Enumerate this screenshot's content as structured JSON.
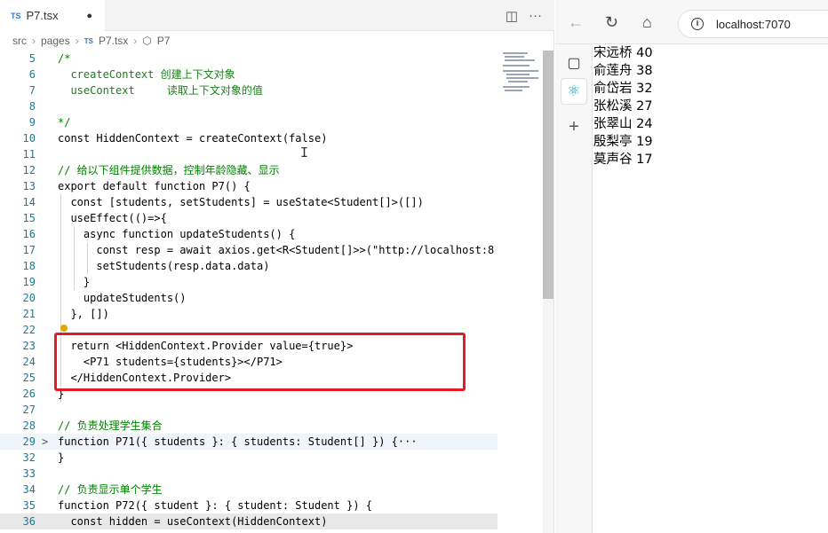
{
  "editor": {
    "tab": {
      "lang_badge": "TS",
      "file_name": "P7.tsx",
      "modified_dot": "●"
    },
    "tab_actions": {
      "split": "◫",
      "more": "···"
    },
    "breadcrumb": {
      "items": [
        "src",
        "pages"
      ],
      "file_badge": "TS",
      "file": "P7.tsx",
      "symbol_icon": "cube-icon",
      "symbol": "P7"
    },
    "lines": [
      {
        "n": "5",
        "t": "/*"
      },
      {
        "n": "6",
        "t": "  createContext 创建上下文对象"
      },
      {
        "n": "7",
        "t": "  useContext     读取上下文对象的值"
      },
      {
        "n": "8",
        "t": ""
      },
      {
        "n": "9",
        "t": "*/"
      },
      {
        "n": "10",
        "t": "const HiddenContext = createContext(false)"
      },
      {
        "n": "11",
        "t": ""
      },
      {
        "n": "12",
        "t": "// 给以下组件提供数据，控制年龄隐藏、显示"
      },
      {
        "n": "13",
        "t": "export default function P7() {"
      },
      {
        "n": "14",
        "t": "  const [students, setStudents] = useState<Student[]>([])"
      },
      {
        "n": "15",
        "t": "  useEffect(()=>{"
      },
      {
        "n": "16",
        "t": "    async function updateStudents() {"
      },
      {
        "n": "17",
        "t": "      const resp = await axios.get<R<Student[]>>(\"http://localhost:8"
      },
      {
        "n": "18",
        "t": "      setStudents(resp.data.data)"
      },
      {
        "n": "19",
        "t": "    }"
      },
      {
        "n": "20",
        "t": "    updateStudents()"
      },
      {
        "n": "21",
        "t": "  }, [])"
      },
      {
        "n": "22",
        "t": ""
      },
      {
        "n": "23",
        "t": "  return <HiddenContext.Provider value={true}>"
      },
      {
        "n": "24",
        "t": "    <P71 students={students}></P71>"
      },
      {
        "n": "25",
        "t": "  </HiddenContext.Provider>"
      },
      {
        "n": "26",
        "t": "}"
      },
      {
        "n": "27",
        "t": ""
      },
      {
        "n": "28",
        "t": "// 负责处理学生集合"
      },
      {
        "n": "29",
        "t": "function P71({ students }: { students: Student[] }) {···",
        "fold": ">"
      },
      {
        "n": "32",
        "t": "}"
      },
      {
        "n": "33",
        "t": ""
      },
      {
        "n": "34",
        "t": "// 负责显示单个学生"
      },
      {
        "n": "35",
        "t": "function P72({ student }: { student: Student }) {"
      },
      {
        "n": "36",
        "t": "  const hidden = useContext(HiddenContext)"
      }
    ]
  },
  "browser": {
    "url": "localhost:7070",
    "nav": {
      "back": "←",
      "refresh": "↻",
      "home": "⌂",
      "info": "i"
    },
    "sidebar": {
      "tabs": "▢",
      "react": "⚛",
      "add": "+"
    },
    "students": [
      {
        "name": "宋远桥",
        "age": "40"
      },
      {
        "name": "俞莲舟",
        "age": "38"
      },
      {
        "name": "俞岱岩",
        "age": "32"
      },
      {
        "name": "张松溪",
        "age": "27"
      },
      {
        "name": "张翠山",
        "age": "24"
      },
      {
        "name": "殷梨亭",
        "age": "19"
      },
      {
        "name": "莫声谷",
        "age": "17"
      }
    ]
  },
  "colors": {
    "highlight_box": "#e11d2a",
    "line_number": "#237893",
    "keyword": "#0000ff",
    "comment": "#008000"
  }
}
